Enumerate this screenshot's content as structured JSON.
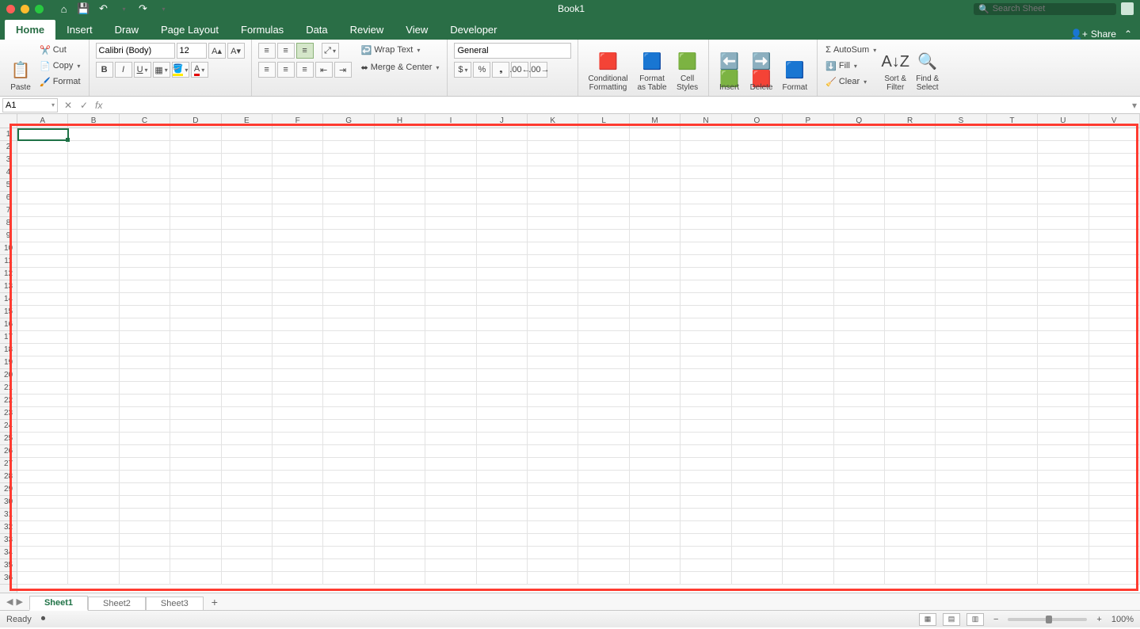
{
  "title": "Book1",
  "search_placeholder": "Search Sheet",
  "tabs": [
    "Home",
    "Insert",
    "Draw",
    "Page Layout",
    "Formulas",
    "Data",
    "Review",
    "View",
    "Developer"
  ],
  "active_tab": 0,
  "share_label": "Share",
  "clipboard": {
    "paste": "Paste",
    "cut": "Cut",
    "copy": "Copy",
    "format": "Format"
  },
  "font": {
    "name": "Calibri (Body)",
    "size": "12"
  },
  "alignment": {
    "wrap": "Wrap Text",
    "merge": "Merge & Center"
  },
  "number_format": "General",
  "styles": {
    "conditional": "Conditional\nFormatting",
    "as_table": "Format\nas Table",
    "cell": "Cell\nStyles"
  },
  "cells_group": {
    "insert": "Insert",
    "delete": "Delete",
    "format": "Format"
  },
  "editing": {
    "autosum": "AutoSum",
    "fill": "Fill",
    "clear": "Clear",
    "sort": "Sort &\nFilter",
    "find": "Find &\nSelect"
  },
  "namebox": "A1",
  "columns": [
    "A",
    "B",
    "C",
    "D",
    "E",
    "F",
    "G",
    "H",
    "I",
    "J",
    "K",
    "L",
    "M",
    "N",
    "O",
    "P",
    "Q",
    "R",
    "S",
    "T",
    "U",
    "V"
  ],
  "row_count": 36,
  "sheets": [
    "Sheet1",
    "Sheet2",
    "Sheet3"
  ],
  "active_sheet": 0,
  "status": "Ready",
  "zoom": "100%"
}
